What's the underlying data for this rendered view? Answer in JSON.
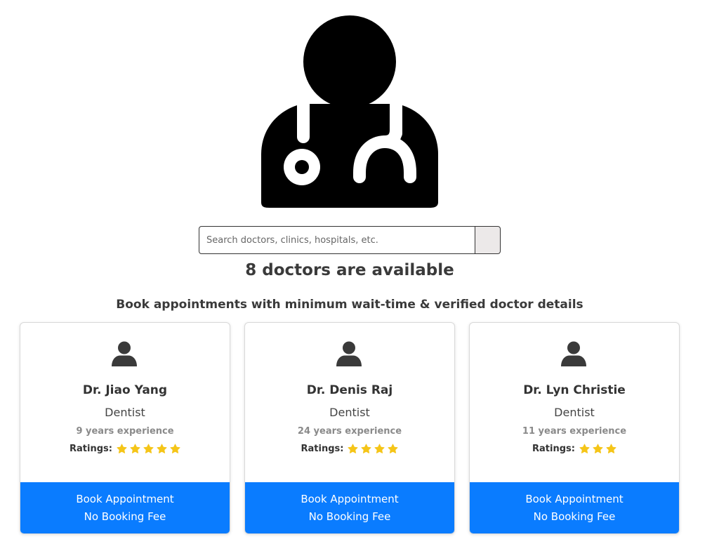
{
  "search": {
    "placeholder": "Search doctors, clinics, hospitals, etc.",
    "value": ""
  },
  "header": {
    "count_title": "8 doctors are available",
    "subtitle": "Book appointments with minimum wait-time & verified doctor details"
  },
  "icons": {
    "hero": "doctor-stethoscope-icon",
    "avatar": "user-icon",
    "rating": "star-icon"
  },
  "colors": {
    "button": "#0a7cff",
    "star": "#f5c518"
  },
  "doctors": [
    {
      "name": "Dr. Jiao Yang",
      "specialty": "Dentist",
      "experience": "9 years experience",
      "ratings_label": "Ratings:",
      "rating": 5,
      "button_line1": "Book Appointment",
      "button_line2": "No Booking Fee"
    },
    {
      "name": "Dr. Denis Raj",
      "specialty": "Dentist",
      "experience": "24 years experience",
      "ratings_label": "Ratings:",
      "rating": 4,
      "button_line1": "Book Appointment",
      "button_line2": "No Booking Fee"
    },
    {
      "name": "Dr. Lyn Christie",
      "specialty": "Dentist",
      "experience": "11 years experience",
      "ratings_label": "Ratings:",
      "rating": 3,
      "button_line1": "Book Appointment",
      "button_line2": "No Booking Fee"
    }
  ]
}
